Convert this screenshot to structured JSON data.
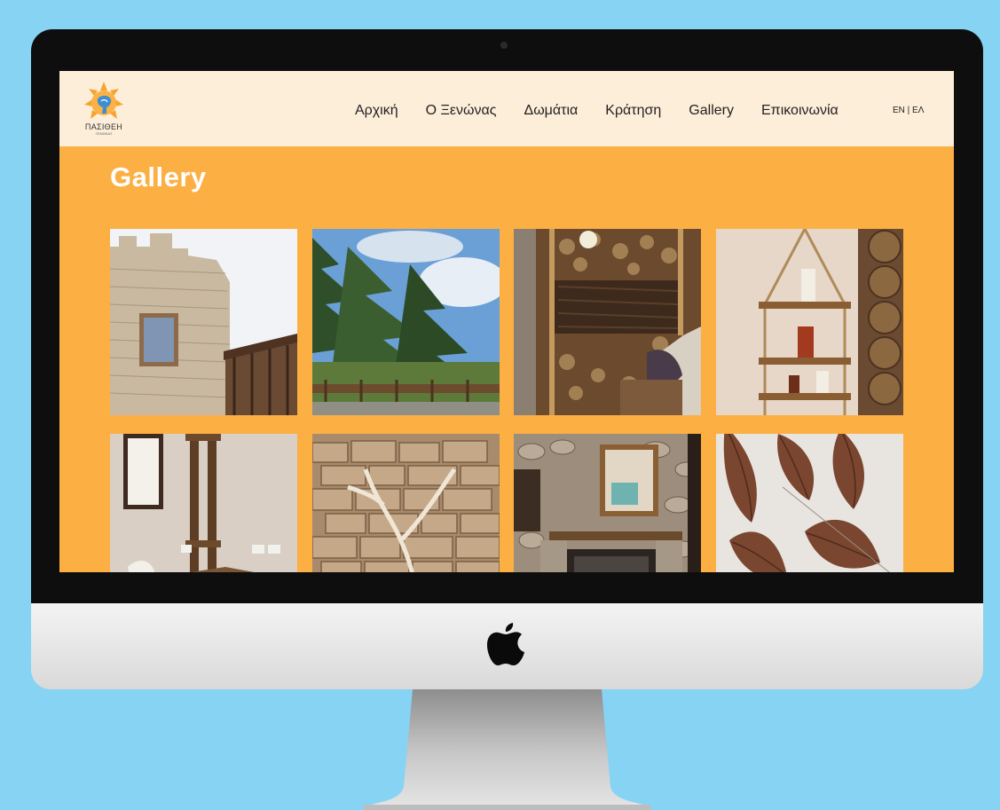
{
  "site": {
    "logo_text": "ΠΑΣΙΘΕΗ",
    "logo_subtext": "ΞΕΝΩΝΑΣ"
  },
  "nav": {
    "items": [
      {
        "label": "Αρχική"
      },
      {
        "label": "Ο Ξενώνας"
      },
      {
        "label": "Δωμάτια"
      },
      {
        "label": "Κράτηση"
      },
      {
        "label": "Gallery"
      },
      {
        "label": "Επικοινωνία"
      }
    ],
    "language_switch": "EN | ΕΛ"
  },
  "page": {
    "title": "Gallery"
  },
  "gallery": {
    "images": [
      {
        "subject": "stone-tower"
      },
      {
        "subject": "pine-trees"
      },
      {
        "subject": "wood-wall-room"
      },
      {
        "subject": "rope-shelf-candles"
      },
      {
        "subject": "mirror-room"
      },
      {
        "subject": "stone-wall-branch"
      },
      {
        "subject": "stone-fireplace"
      },
      {
        "subject": "dried-leaves"
      }
    ]
  },
  "colors": {
    "page_background": "#87d3f3",
    "site_background": "#fcaf43",
    "navbar_background": "#fdeed9"
  }
}
